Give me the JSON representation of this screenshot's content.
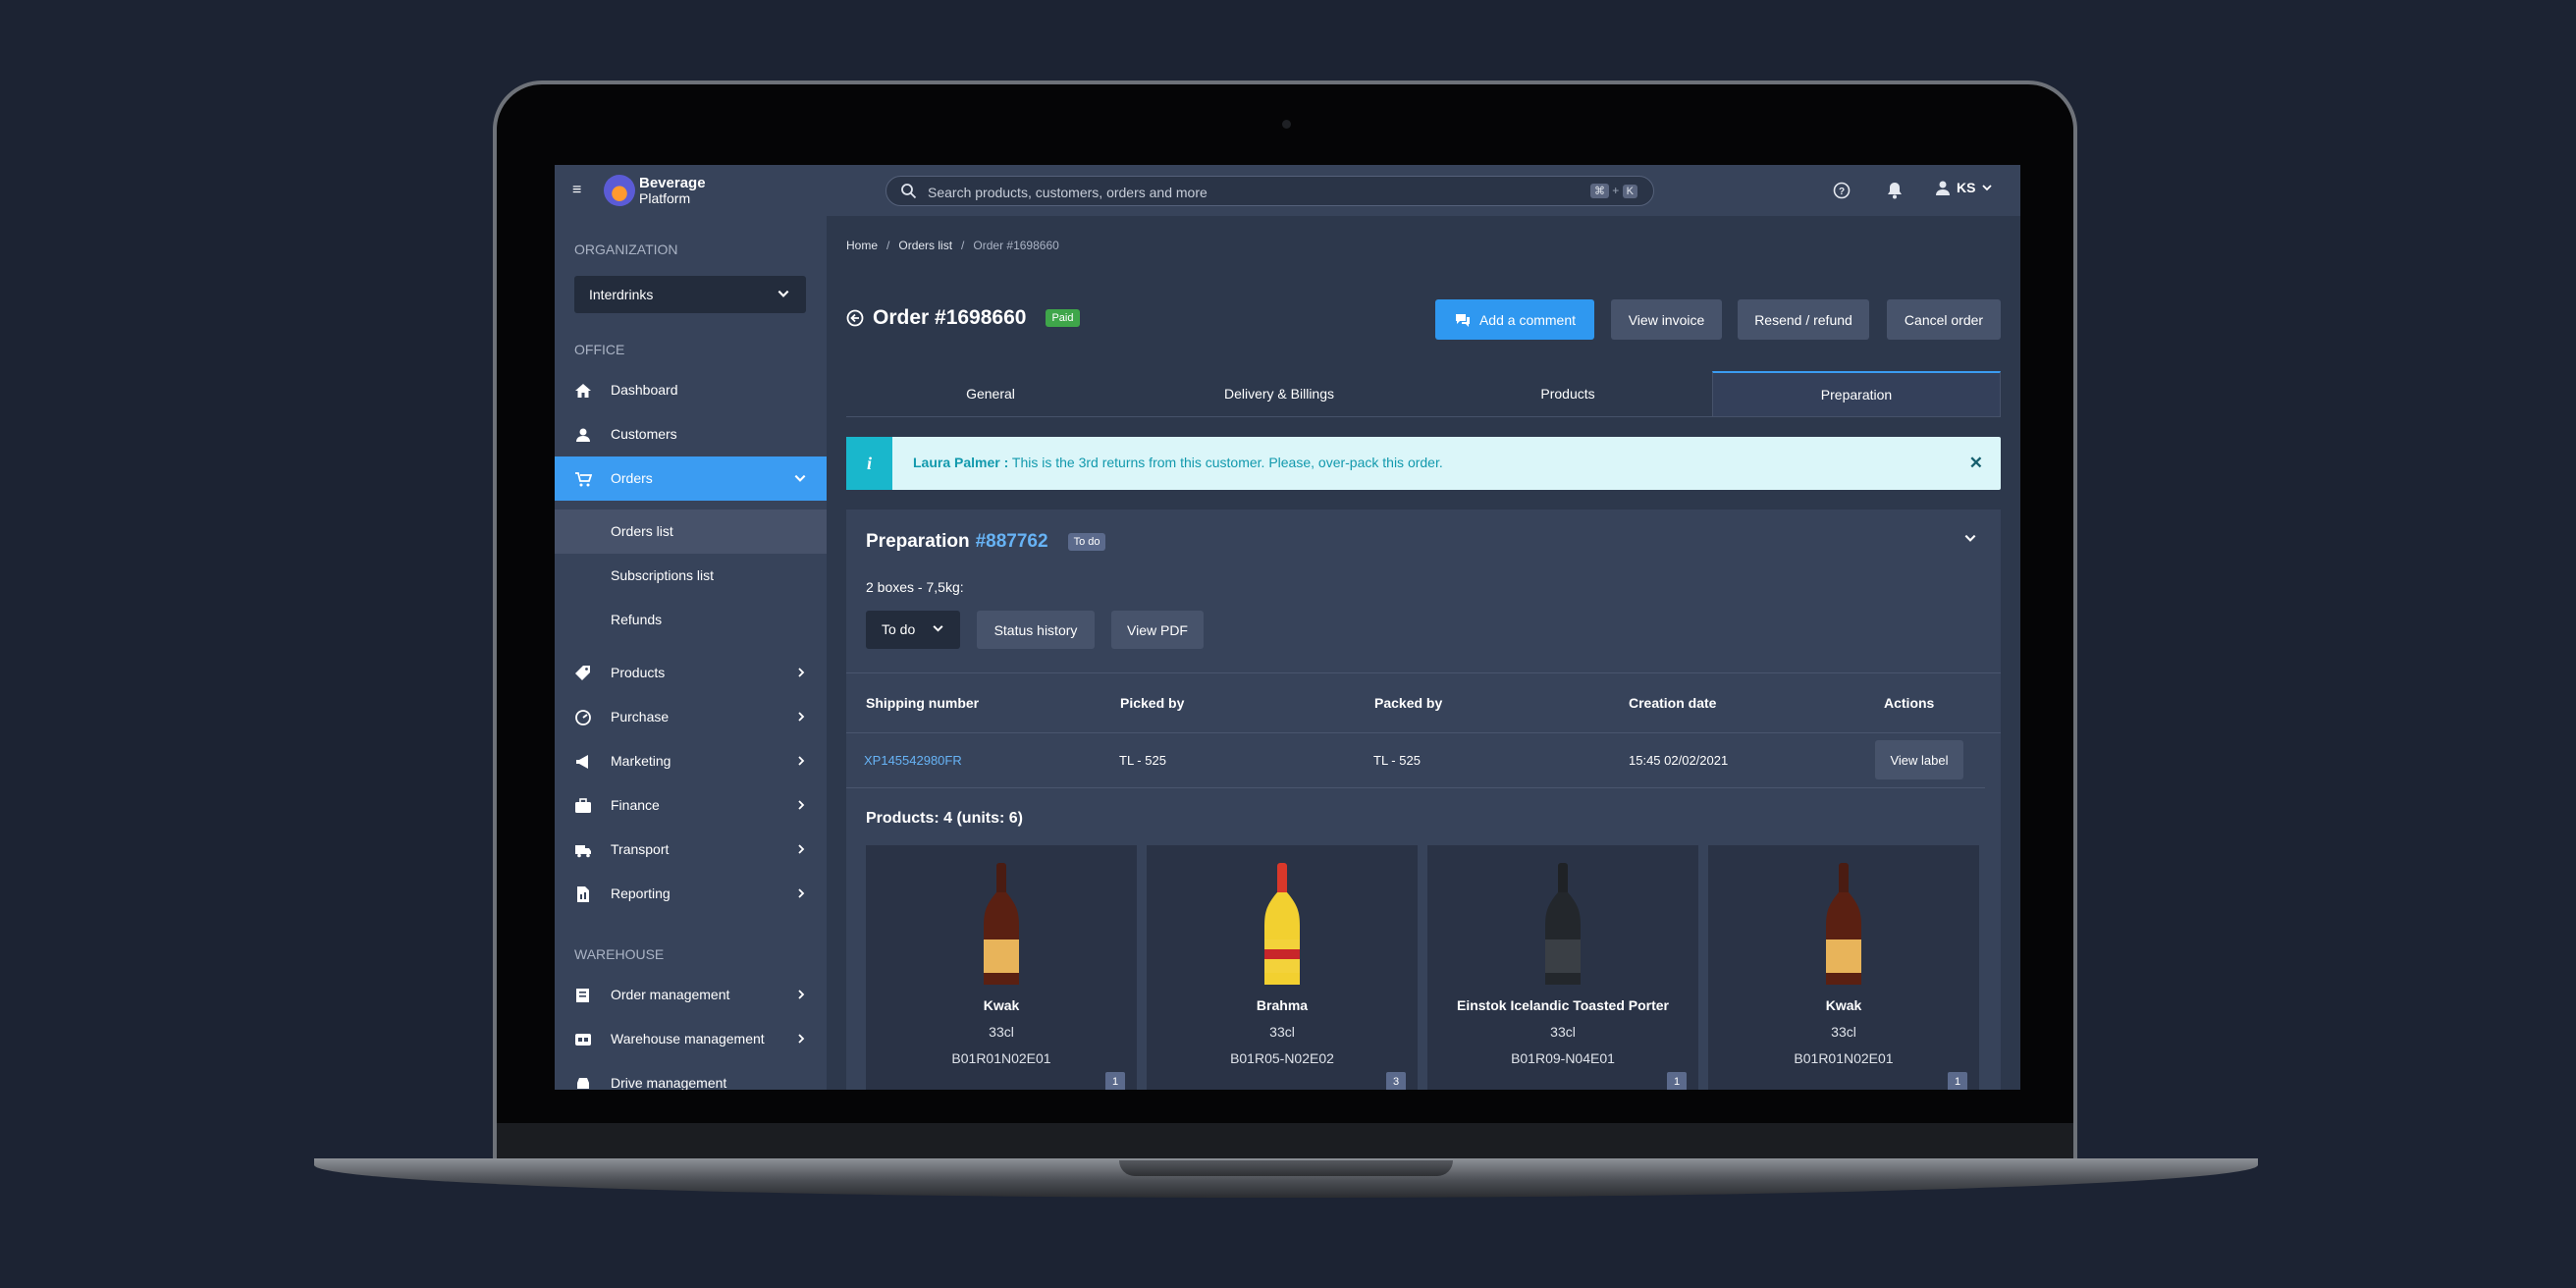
{
  "topbar": {
    "brand_line1": "Beverage",
    "brand_line2": "Platform",
    "search_placeholder": "Search products, customers, orders and more",
    "shortcut_key1": "⌘",
    "shortcut_plus": "+",
    "shortcut_key2": "K",
    "user_initials": "KS"
  },
  "sidebar": {
    "section_organization": "ORGANIZATION",
    "organization_value": "Interdrinks",
    "section_office": "OFFICE",
    "office_items": [
      {
        "label": "Dashboard",
        "icon": "home-icon"
      },
      {
        "label": "Customers",
        "icon": "user-icon"
      },
      {
        "label": "Orders",
        "icon": "cart-icon",
        "active": true
      }
    ],
    "orders_sub": [
      "Orders list",
      "Subscriptions list",
      "Refunds"
    ],
    "office_items2": [
      {
        "label": "Products",
        "icon": "tag-icon"
      },
      {
        "label": "Purchase",
        "icon": "gauge-icon"
      },
      {
        "label": "Marketing",
        "icon": "megaphone-icon"
      },
      {
        "label": "Finance",
        "icon": "briefcase-icon"
      },
      {
        "label": "Transport",
        "icon": "truck-icon"
      },
      {
        "label": "Reporting",
        "icon": "report-icon"
      }
    ],
    "section_warehouse": "WAREHOUSE",
    "warehouse_items": [
      {
        "label": "Order management",
        "icon": "book-icon"
      },
      {
        "label": "Warehouse management",
        "icon": "warehouse-icon"
      },
      {
        "label": "Drive management",
        "icon": "car-icon"
      }
    ]
  },
  "breadcrumb": {
    "home": "Home",
    "list": "Orders list",
    "current": "Order #1698660"
  },
  "order": {
    "title": "Order #1698660",
    "status": "Paid",
    "buttons": {
      "comment": "Add a comment",
      "invoice": "View invoice",
      "resend": "Resend / refund",
      "cancel": "Cancel order"
    }
  },
  "tabs": [
    "General",
    "Delivery & Billings",
    "Products",
    "Preparation"
  ],
  "alert": {
    "name": "Laura Palmer :",
    "message": " This is the 3rd returns from this customer. Please, over-pack this order."
  },
  "preparation": {
    "title": "Preparation",
    "number": "#887762",
    "status": "To do",
    "boxes": "2 boxes - 7,5kg:",
    "select_value": "To do",
    "status_history": "Status history",
    "view_pdf": "View PDF",
    "columns": [
      "Shipping number",
      "Picked by",
      "Packed by",
      "Creation date",
      "Actions"
    ],
    "row": {
      "shipping": "XP145542980FR",
      "picked": "TL - 525",
      "packed": "TL - 525",
      "date": "15:45 02/02/2021",
      "action": "View label"
    },
    "products_heading": "Products: 4 (units: 6)",
    "products": [
      {
        "name": "Kwak",
        "size": "33cl",
        "sku": "B01R01N02E01",
        "qty": "1",
        "label_color": "#e8b45a"
      },
      {
        "name": "Brahma",
        "size": "33cl",
        "sku": "B01R05-N02E02",
        "qty": "3",
        "label_color": "#f3d23a"
      },
      {
        "name": "Einstok Icelandic Toasted Porter",
        "size": "33cl",
        "sku": "B01R09-N04E01",
        "qty": "1",
        "label_color": "#3a3f45"
      },
      {
        "name": "Kwak",
        "size": "33cl",
        "sku": "B01R01N02E01",
        "qty": "1",
        "label_color": "#e8b45a"
      }
    ]
  }
}
